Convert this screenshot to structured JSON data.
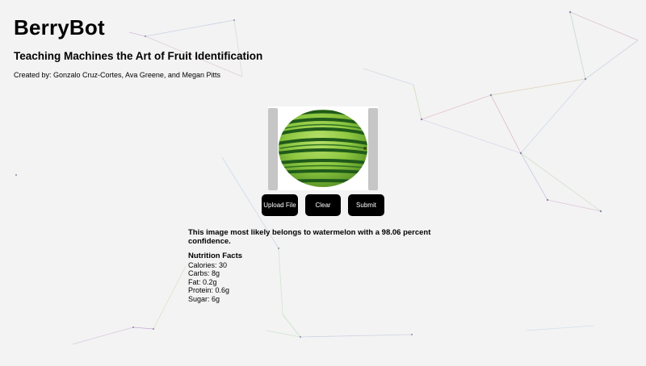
{
  "app": {
    "title": "BerryBot",
    "subtitle": "Teaching Machines the Art of Fruit Identification",
    "credits": "Created by: Gonzalo Cruz-Cortes, Ava Greene, and Megan Pitts"
  },
  "buttons": {
    "upload_label": "Upload File",
    "clear_label": "Clear",
    "submit_label": "Submit"
  },
  "result": {
    "text": "This image most likely belongs to watermelon with a 98.06 percent confidence."
  },
  "nutrition": {
    "title": "Nutrition Facts",
    "items": [
      "Calories: 30",
      "Carbs: 8g",
      "Fat: 0.2g",
      "Protein: 0.6g",
      "Sugar: 6g"
    ]
  },
  "colors": {
    "background": "#f3f3f3",
    "button": "#000000",
    "button_text": "#ffffff",
    "watermelon_light": "#8cc63f",
    "watermelon_dark": "#1f5a1a"
  }
}
